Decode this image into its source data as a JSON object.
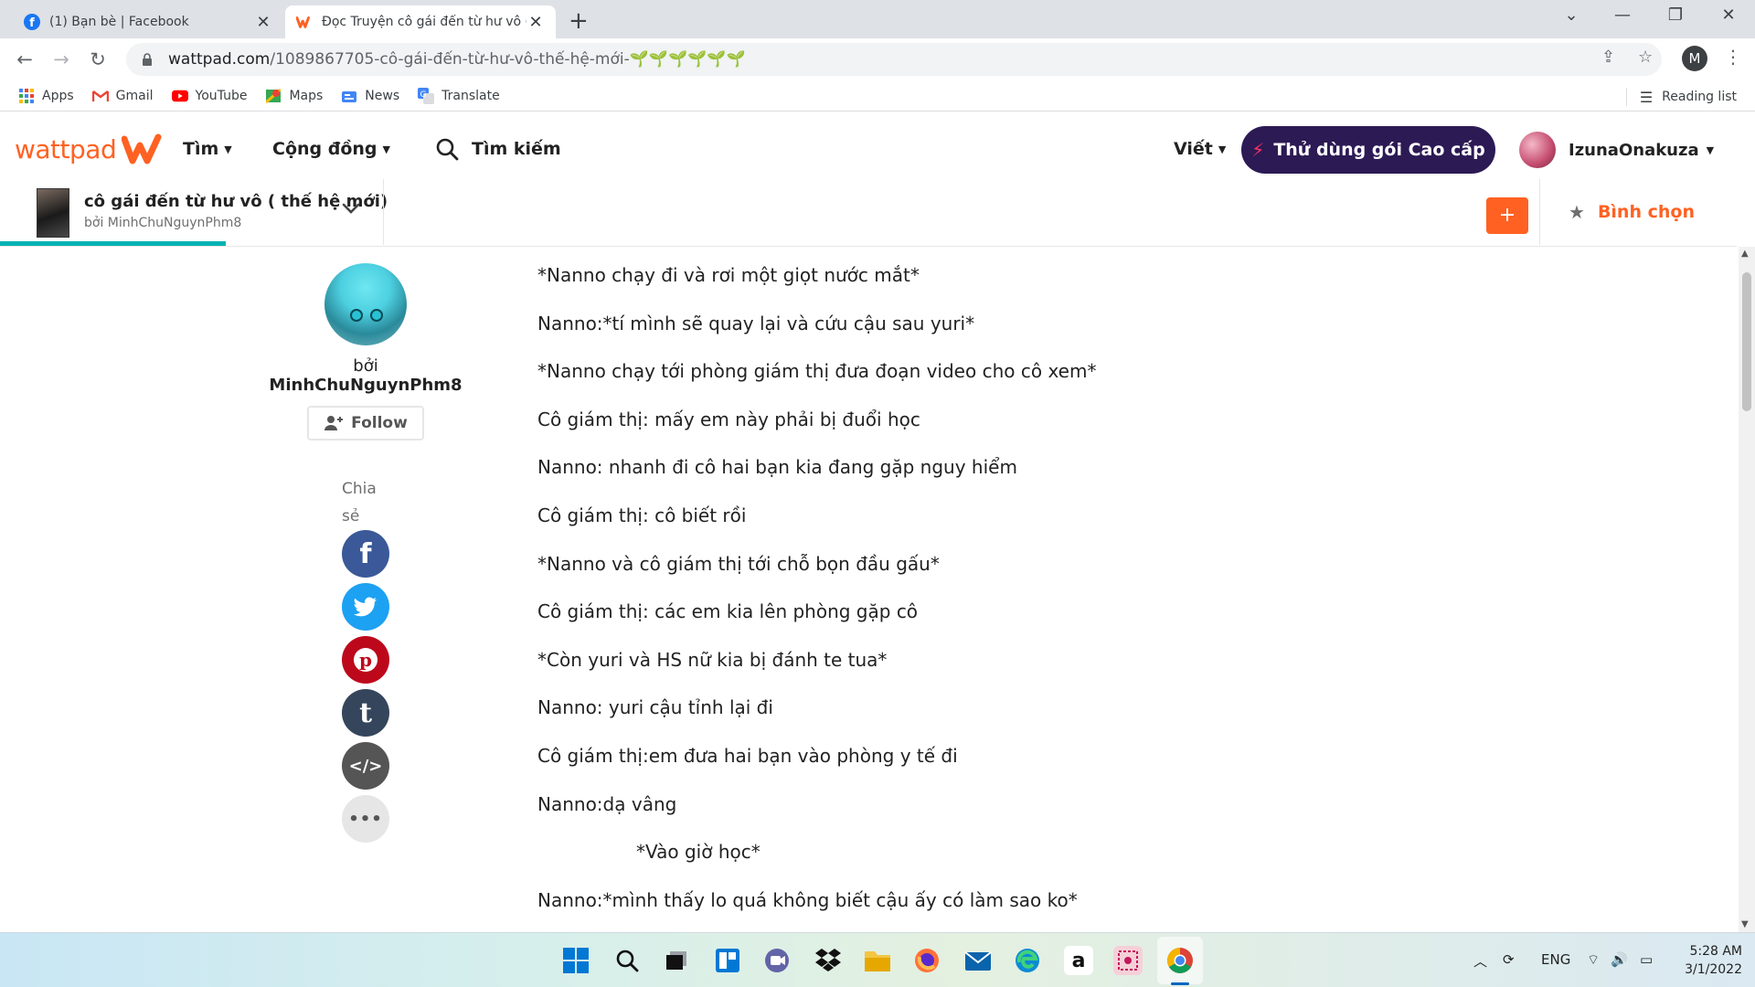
{
  "browser": {
    "tabs": [
      {
        "title": "(1) Bạn bè | Facebook",
        "active": false,
        "icon": "facebook-icon"
      },
      {
        "title": "Đọc Truyện cô gái đến từ hư vô (",
        "active": true,
        "icon": "wattpad-icon"
      }
    ],
    "url_host": "wattpad.com",
    "url_path": "/1089867705-cô-gái-đến-từ-hư-vô-thế-hệ-mới-🌱🌱🌱🌱🌱🌱",
    "profile_initial": "M",
    "bookmarks": [
      "Apps",
      "Gmail",
      "YouTube",
      "Maps",
      "News",
      "Translate"
    ],
    "reading_list": "Reading list"
  },
  "header": {
    "logo_text": "wattpad",
    "nav_discover": "Tìm",
    "nav_community": "Cộng đồng",
    "search_label": "Tìm kiếm",
    "write_label": "Viết",
    "premium_label": "Thử dùng gói Cao cấp",
    "username": "IzunaOnakuza",
    "brand_color": "#ff6122",
    "premium_color": "#2c1a55"
  },
  "story": {
    "title": "cô gái đến từ hư vô ( thế hệ mới)",
    "by_line": "bởi MinhChuNguynPhm8",
    "add_label": "+",
    "vote_label": "Bình chọn",
    "progress_fraction": 0.13
  },
  "author": {
    "by_prefix": "bởi",
    "name": "MinhChuNguynPhm8",
    "follow_label": "Follow"
  },
  "share": {
    "label_line1": "Chia",
    "label_line2": "sẻ",
    "buttons": [
      {
        "name": "facebook",
        "glyph": "f",
        "color": "#3b5998"
      },
      {
        "name": "twitter",
        "glyph": "🐦",
        "color": "#1da1f2"
      },
      {
        "name": "pinterest",
        "glyph": "P",
        "color": "#bd081c"
      },
      {
        "name": "tumblr",
        "glyph": "t",
        "color": "#35465c"
      },
      {
        "name": "embed",
        "glyph": "</>",
        "color": "#555555"
      },
      {
        "name": "more",
        "glyph": "•••",
        "color": "#e6e6e6"
      }
    ]
  },
  "content": {
    "lines": [
      "*Nanno chạy đi và rơi một giọt nước mắt*",
      "Nanno:*tí mình sẽ quay lại và cứu cậu sau yuri*",
      "*Nanno chạy tới phòng giám thị đưa đoạn video cho cô xem*",
      "Cô giám thị: mấy em này phải bị đuổi học",
      "Nanno: nhanh đi cô hai bạn kia đang gặp nguy hiểm",
      "Cô giám thị: cô biết rồi",
      "*Nanno và cô giám thị tới chỗ bọn đầu gấu*",
      "Cô giám thị: các em kia lên phòng gặp cô",
      "*Còn yuri và HS nữ kia bị đánh te tua*",
      "Nanno: yuri cậu tỉnh lại đi",
      "Cô giám thị:em đưa hai bạn vào phòng y tế đi",
      "Nanno:dạ vâng",
      "*Vào giờ học*",
      "Nanno:*mình thấy lo quá không biết cậu ấy có làm sao ko*"
    ]
  },
  "taskbar": {
    "lang": "ENG",
    "time": "5:28 AM",
    "date": "3/1/2022"
  }
}
